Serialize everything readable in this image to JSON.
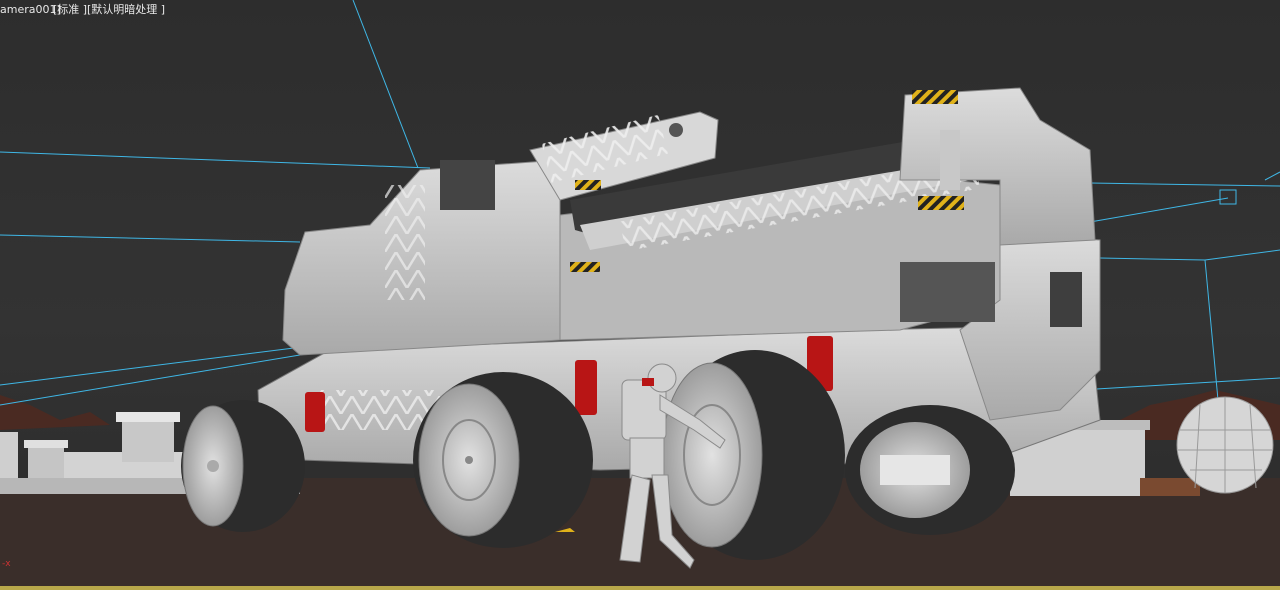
{
  "viewport": {
    "camera_label": "amera001]",
    "shading_label": "[标准 ]",
    "lighting_label": "[默认明暗处理 ]",
    "axis_label": "-x"
  },
  "colors": {
    "background": "#2d2d2d",
    "ground": "#3a2e2a",
    "camera_lines": "#3fb7e6",
    "vehicle_body": "#c9c9c9",
    "tire": "#2c2c2c",
    "accent_red": "#b81515",
    "hazard_yellow": "#e0b21a"
  }
}
